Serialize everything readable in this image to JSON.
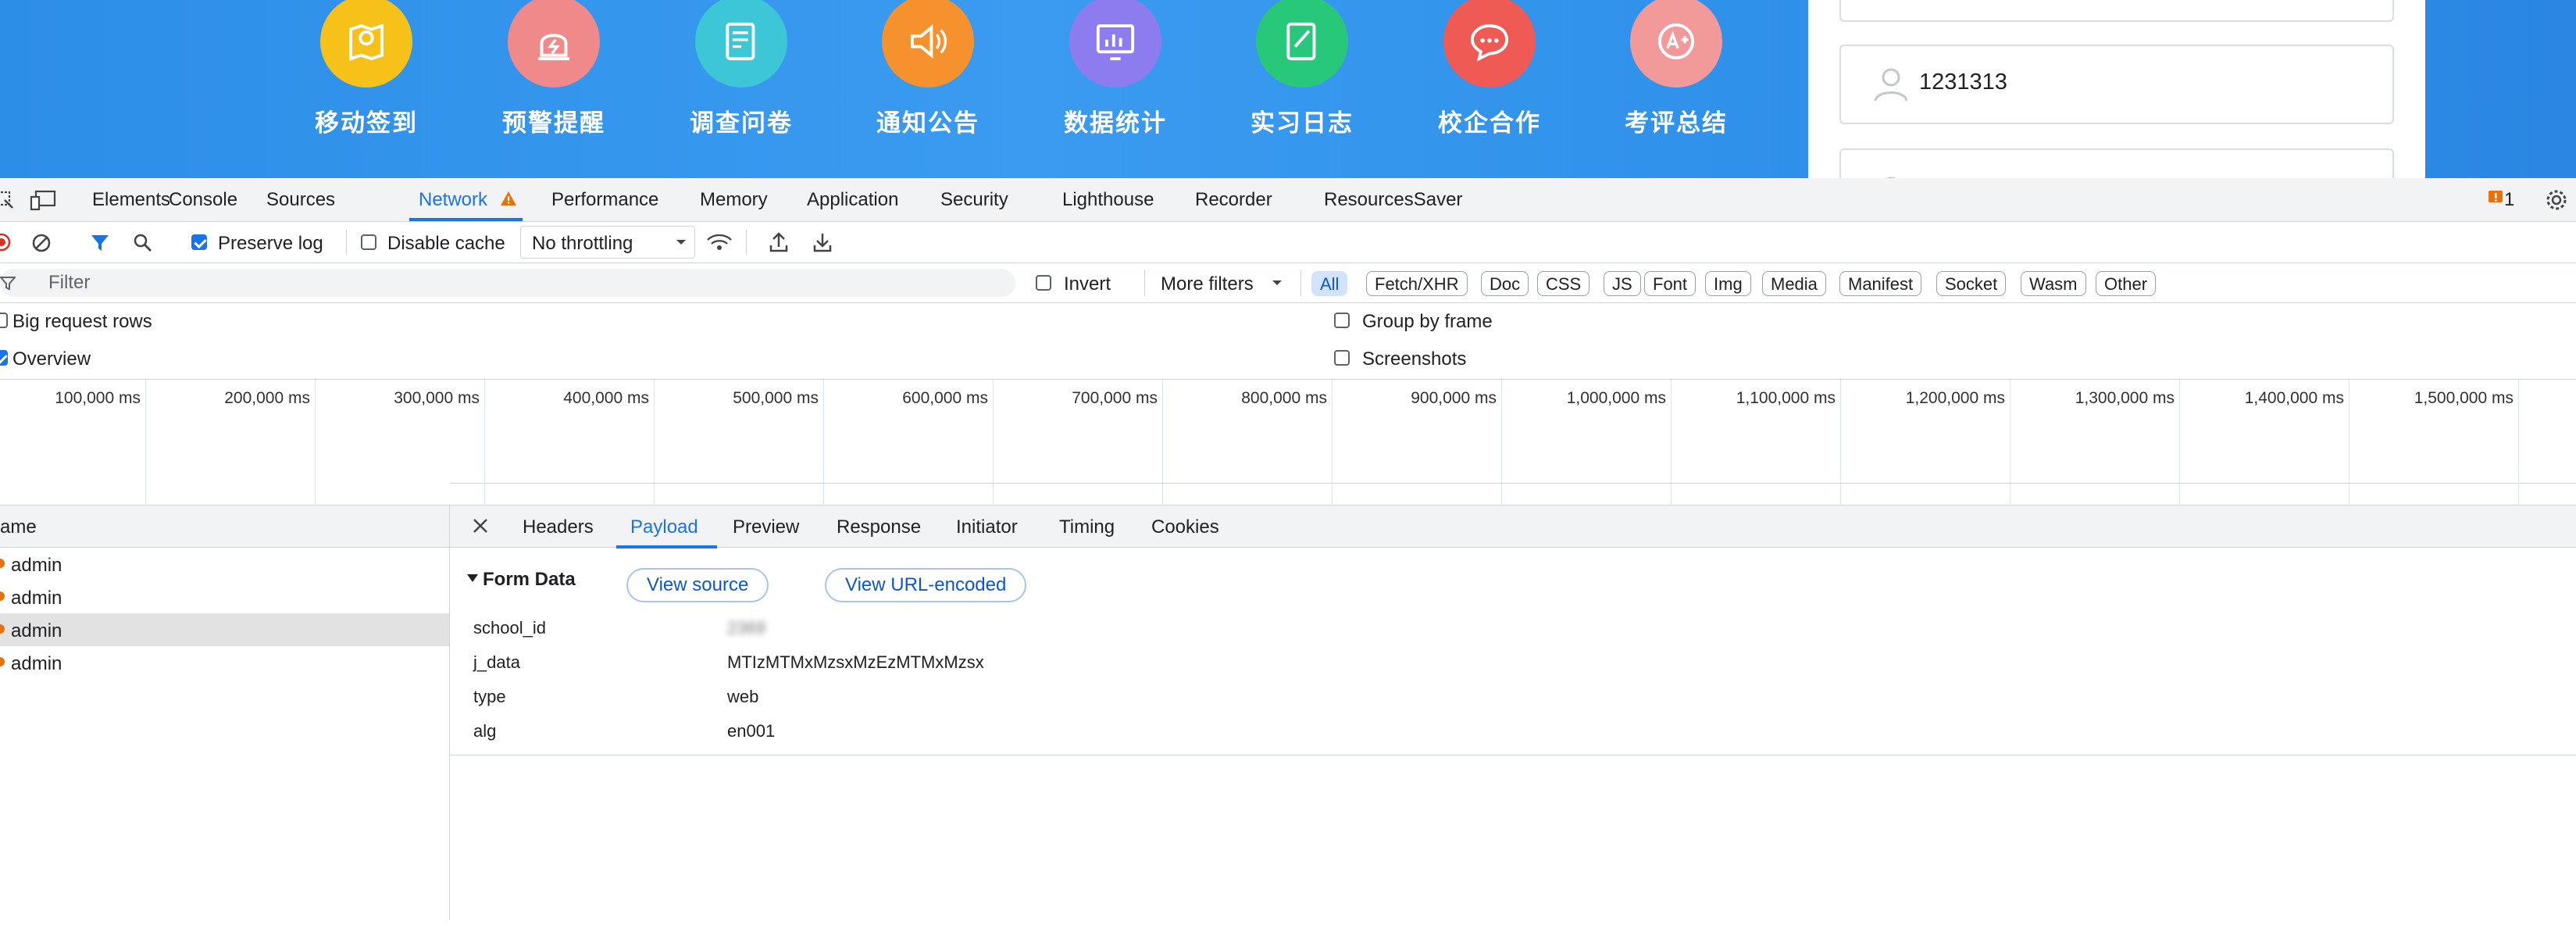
{
  "webpage": {
    "apps": [
      {
        "label": "移动签到",
        "icon": "map-pin-icon",
        "color": "#f6c21a"
      },
      {
        "label": "预警提醒",
        "icon": "alarm-light-icon",
        "color": "#f08a8a"
      },
      {
        "label": "调查问卷",
        "icon": "survey-form-icon",
        "color": "#3cc6d6"
      },
      {
        "label": "通知公告",
        "icon": "speaker-icon",
        "color": "#f5922d"
      },
      {
        "label": "数据统计",
        "icon": "bar-chart-icon",
        "color": "#8c7cf0"
      },
      {
        "label": "实习日志",
        "icon": "notebook-pen-icon",
        "color": "#28c87a"
      },
      {
        "label": "校企合作",
        "icon": "chat-bubble-icon",
        "color": "#ef5a55"
      },
      {
        "label": "考评总结",
        "icon": "grade-a-plus-icon",
        "color": "#f29a9a"
      }
    ],
    "login": {
      "username_value": "1231313"
    }
  },
  "devtools": {
    "tabs": [
      "Elements",
      "Console",
      "Sources",
      "Network",
      "Performance",
      "Memory",
      "Application",
      "Security",
      "Lighthouse",
      "Recorder",
      "ResourcesSaver"
    ],
    "active_tab": "Network",
    "issues_count": "1",
    "toolbar": {
      "preserve_log_label": "Preserve log",
      "preserve_log_checked": true,
      "disable_cache_label": "Disable cache",
      "disable_cache_checked": false,
      "throttling_value": "No throttling"
    },
    "filterbar": {
      "filter_placeholder": "Filter",
      "invert_label": "Invert",
      "more_filters_label": "More filters",
      "type_chips": [
        "All",
        "Fetch/XHR",
        "Doc",
        "CSS",
        "JS",
        "Font",
        "Img",
        "Media",
        "Manifest",
        "Socket",
        "Wasm",
        "Other"
      ],
      "active_chip": "All"
    },
    "settings": {
      "big_request_rows_label": "Big request rows",
      "overview_label": "Overview",
      "group_by_frame_label": "Group by frame",
      "screenshots_label": "Screenshots"
    },
    "timeline_ticks": [
      "100,000 ms",
      "200,000 ms",
      "300,000 ms",
      "400,000 ms",
      "500,000 ms",
      "600,000 ms",
      "700,000 ms",
      "800,000 ms",
      "900,000 ms",
      "1,000,000 ms",
      "1,100,000 ms",
      "1,200,000 ms",
      "1,300,000 ms",
      "1,400,000 ms",
      "1,500,000 ms"
    ],
    "request_list": {
      "header": "ame",
      "rows": [
        "admin",
        "admin",
        "admin",
        "admin"
      ],
      "selected_index": 2
    },
    "detail": {
      "tabs": [
        "Headers",
        "Payload",
        "Preview",
        "Response",
        "Initiator",
        "Timing",
        "Cookies"
      ],
      "active_tab": "Payload",
      "section_title": "Form Data",
      "view_source_label": "View source",
      "view_url_encoded_label": "View URL-encoded",
      "form_data": [
        {
          "key": "school_id",
          "value": "2369",
          "blurred": true
        },
        {
          "key": "j_data",
          "value": "MTIzMTMxMzsxMzEzMTMxMzsx",
          "blurred": false
        },
        {
          "key": "type",
          "value": "web",
          "blurred": false
        },
        {
          "key": "alg",
          "value": "en001",
          "blurred": false
        }
      ]
    },
    "colors": {
      "accent": "#1a73e8",
      "warning": "#e8710a"
    }
  }
}
